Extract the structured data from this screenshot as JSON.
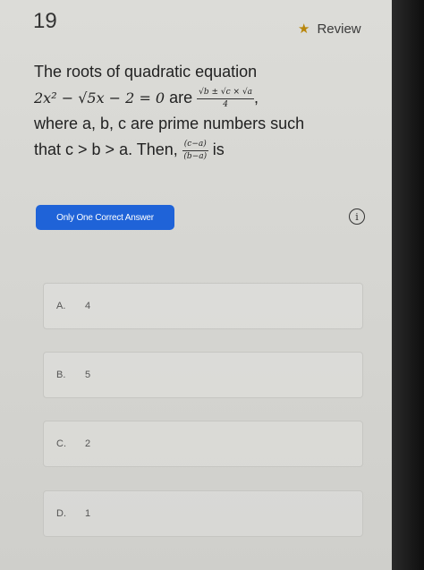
{
  "question": {
    "number": "19",
    "review_label": "Review",
    "line1": "The roots of quadratic equation",
    "equation": "2x² − √5x − 2 = 0",
    "are": " are ",
    "frac_num": "√b ± √c × √a",
    "frac_den": "4",
    "comma": ",",
    "line3": "where a, b, c are prime numbers such",
    "line4_pre": "that c > b > a. Then, ",
    "ratio_num": "(c−a)",
    "ratio_den": "(b−a)",
    "line4_post": " is"
  },
  "badge": "Only One Correct Answer",
  "info_icon_glyph": "i",
  "options": [
    {
      "letter": "A.",
      "text": "4"
    },
    {
      "letter": "B.",
      "text": "5"
    },
    {
      "letter": "C.",
      "text": "2"
    },
    {
      "letter": "D.",
      "text": "1"
    }
  ],
  "colors": {
    "badge": "#1f63d8",
    "star": "#b8860b"
  }
}
